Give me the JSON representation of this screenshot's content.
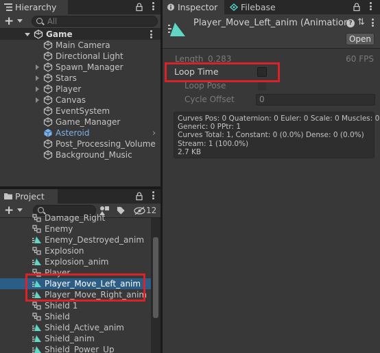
{
  "hierarchy": {
    "tab_label": "Hierarchy",
    "search_placeholder": "All",
    "scene": "Game",
    "items": [
      {
        "label": "Main Camera",
        "foldout": false
      },
      {
        "label": "Directional Light",
        "foldout": false
      },
      {
        "label": "Spawn_Manager",
        "foldout": true
      },
      {
        "label": "Stars",
        "foldout": true
      },
      {
        "label": "Player",
        "foldout": true
      },
      {
        "label": "Canvas",
        "foldout": true
      },
      {
        "label": "EventSystem",
        "foldout": false
      },
      {
        "label": "Game_Manager",
        "foldout": false
      },
      {
        "label": "Asteroid",
        "foldout": false
      },
      {
        "label": "Post_Processing_Volume",
        "foldout": false
      },
      {
        "label": "Background_Music",
        "foldout": false
      }
    ]
  },
  "project": {
    "tab_label": "Project",
    "hidden_count": "12",
    "items": [
      {
        "label": "Damage_Right",
        "icon": "prefab-icon"
      },
      {
        "label": "Enemy",
        "icon": "prefab-icon"
      },
      {
        "label": "Enemy_Destroyed_anim",
        "icon": "animation-clip-icon"
      },
      {
        "label": "Explosion",
        "icon": "prefab-icon"
      },
      {
        "label": "Explosion_anim",
        "icon": "animation-clip-icon"
      },
      {
        "label": "Player",
        "icon": "prefab-icon"
      },
      {
        "label": "Player_Move_Left_anim",
        "icon": "animation-clip-icon"
      },
      {
        "label": "Player_Move_Right_anim",
        "icon": "animation-clip-icon"
      },
      {
        "label": "Shield 1",
        "icon": "prefab-icon"
      },
      {
        "label": "Shield",
        "icon": "prefab-icon"
      },
      {
        "label": "Shield_Active_anim",
        "icon": "animation-clip-icon"
      },
      {
        "label": "Shield_anim",
        "icon": "animation-clip-icon"
      },
      {
        "label": "Shield_Power_Up",
        "icon": "animation-clip-icon"
      }
    ]
  },
  "inspector": {
    "tab_label": "Inspector",
    "filebase_tab_label": "Filebase",
    "asset_title": "Player_Move_Left_anim (Animation",
    "open_button": "Open",
    "length_label": "Length",
    "length_value": "0.283",
    "fps": "60 FPS",
    "loop_time_label": "Loop Time",
    "loop_pose_label": "Loop Pose",
    "cycle_offset_label": "Cycle Offset",
    "cycle_offset_value": "0",
    "info_lines": [
      "Curves Pos: 0 Quaternion: 0 Euler: 0 Scale: 0 Muscles: 0",
      "Generic: 0 PPtr: 1",
      "Curves Total: 1, Constant: 0 (0.0%) Dense: 0 (0.0%)",
      "Stream: 1 (100.0%)",
      "2.7 KB"
    ]
  },
  "colors": {
    "selection": "#2c5d87",
    "highlight_box": "#d9232b",
    "asteroid_text": "#7cb2e8",
    "anim_icon": "#5fd7c4"
  }
}
